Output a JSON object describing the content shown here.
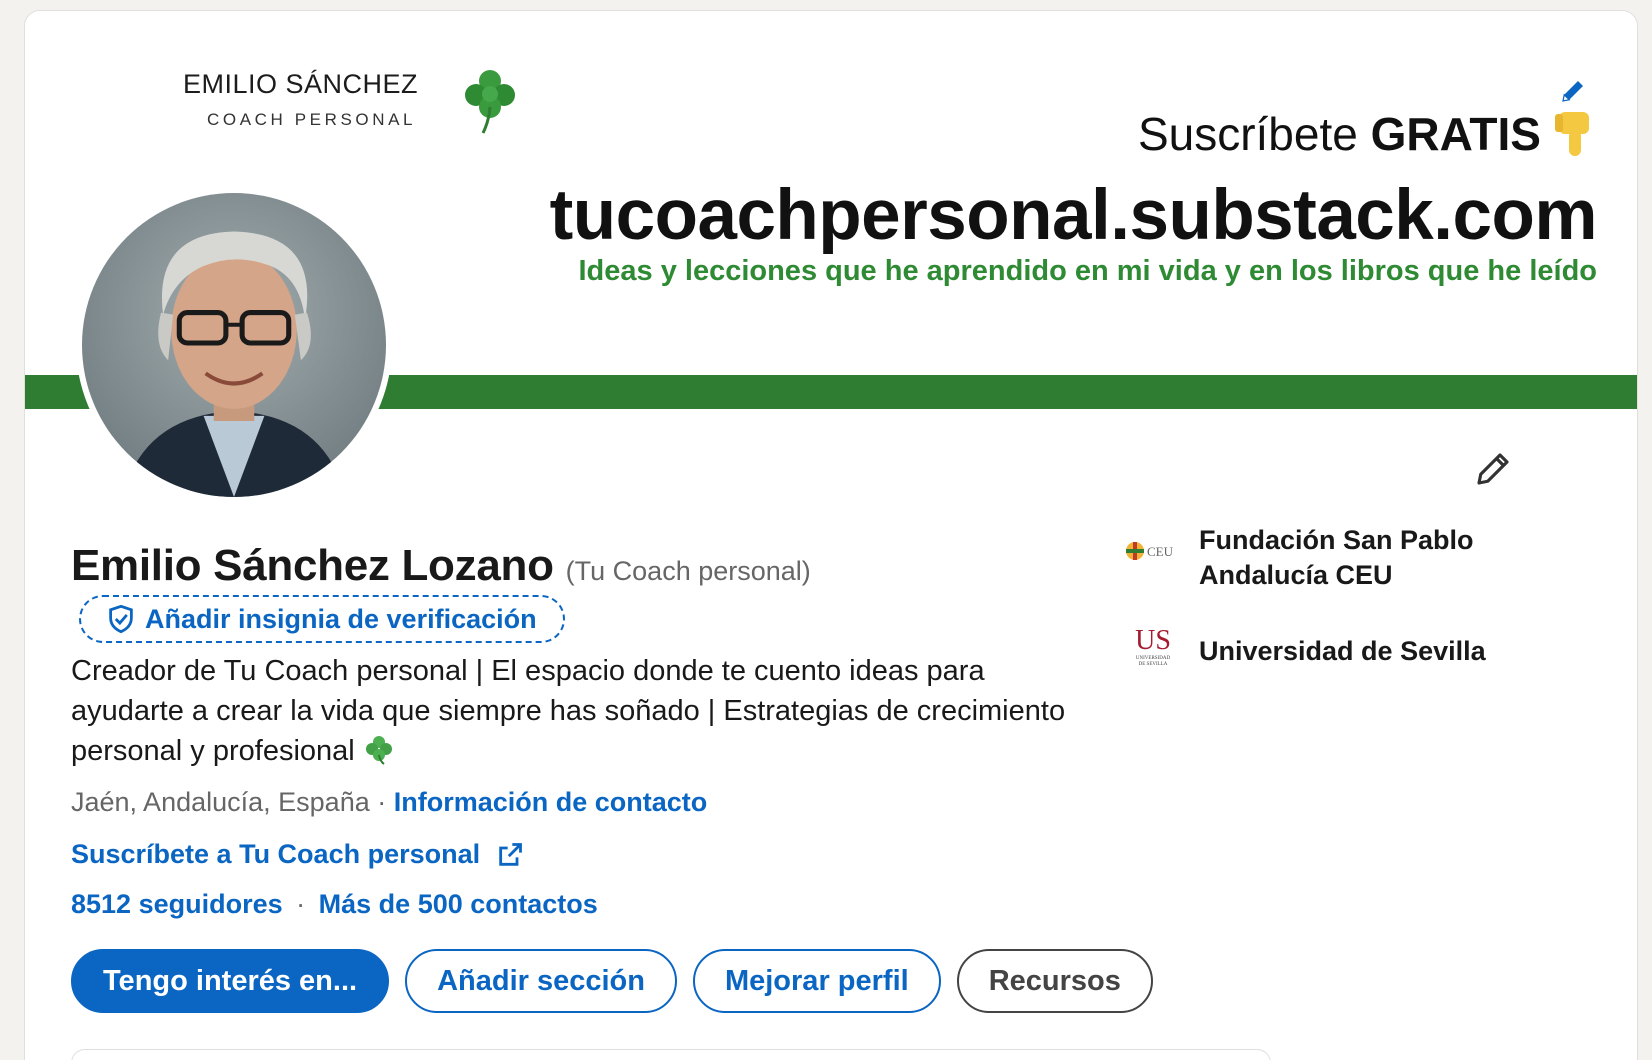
{
  "banner": {
    "brand_name": "EMILIO SÁNCHEZ",
    "brand_sub": "COACH PERSONAL",
    "subscribe_prefix": "Suscríbete",
    "subscribe_bold": "GRATIS",
    "site": "tucoachpersonal.substack.com",
    "tagline": "Ideas y lecciones que he aprendido en mi vida y en los libros que he leído",
    "stripe_color": "#2f7d32",
    "tagline_color": "#2f8a34"
  },
  "profile": {
    "name": "Emilio Sánchez Lozano",
    "pronoun": "(Tu Coach personal)",
    "verify_label": "Añadir insignia de verificación",
    "headline": "Creador de Tu Coach personal | El espacio donde te cuento ideas para ayudarte a crear la vida que siempre has soñado | Estrategias de crecimiento personal y profesional",
    "location": "Jaén, Andalucía, España",
    "location_sep": " · ",
    "contact_link": "Información de contacto",
    "newsletter": "Suscríbete a Tu Coach personal",
    "followers": "8512 seguidores",
    "network_sep": "·",
    "connections": "Más de 500 contactos"
  },
  "actions": {
    "open_to": "Tengo interés en...",
    "add_section": "Añadir sección",
    "enhance": "Mejorar perfil",
    "resources": "Recursos"
  },
  "experience": [
    {
      "name_line1": "Fundación San Pablo",
      "name_line2": "Andalucía CEU",
      "logo_text": "CEU",
      "logo_icon": "ceu-cross-icon"
    },
    {
      "name_line1": "Universidad de Sevilla",
      "logo_text": "US",
      "logo_sub": "UNIVERSIDAD\nDE SEVILLA",
      "logo_icon": "us-logo"
    }
  ],
  "colors": {
    "accent": "#0a66c2",
    "muted": "#666666"
  }
}
